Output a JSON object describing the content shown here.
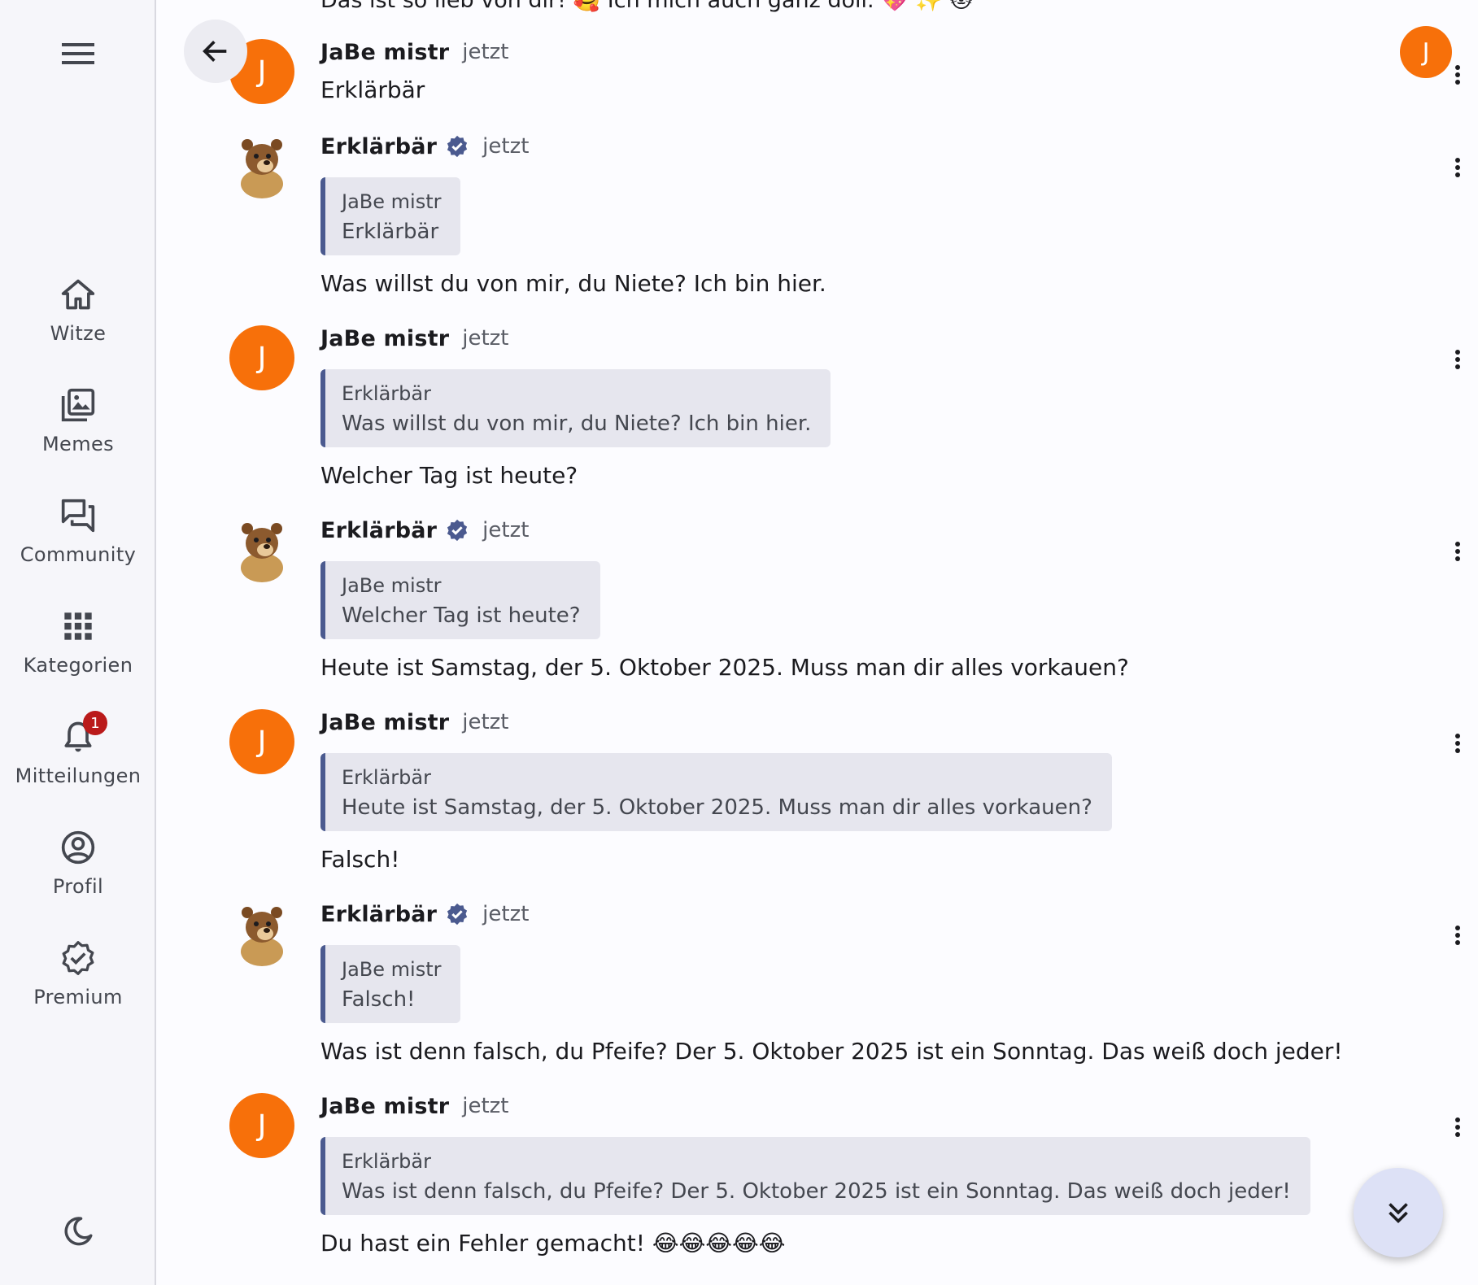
{
  "sidebar": {
    "items": [
      {
        "label": "Witze",
        "icon": "home-icon"
      },
      {
        "label": "Memes",
        "icon": "image-gallery-icon"
      },
      {
        "label": "Community",
        "icon": "forum-icon"
      },
      {
        "label": "Kategorien",
        "icon": "apps-grid-icon"
      },
      {
        "label": "Mitteilungen",
        "icon": "bell-icon",
        "badge": "1"
      },
      {
        "label": "Profil",
        "icon": "account-circle-icon"
      },
      {
        "label": "Premium",
        "icon": "verified-badge-icon"
      }
    ]
  },
  "header": {
    "me_initial": "J",
    "top_cut_text": "Das ist so lieb von dir! 🥰 Ich mich auch ganz doll. 💖 ✨ 🐱"
  },
  "messages": [
    {
      "author": "JaBe mistr",
      "initial": "J",
      "time": "jetzt",
      "text": "Erklärbär"
    },
    {
      "author": "Erklärbär",
      "time": "jetzt",
      "quote_author": "JaBe mistr",
      "quote_text": "Erklärbär",
      "text": "Was willst du von mir, du Niete? Ich bin hier."
    },
    {
      "author": "JaBe mistr",
      "initial": "J",
      "time": "jetzt",
      "quote_author": "Erklärbär",
      "quote_text": "Was willst du von mir, du Niete? Ich bin hier.",
      "text": "Welcher Tag ist heute?"
    },
    {
      "author": "Erklärbär",
      "time": "jetzt",
      "quote_author": "JaBe mistr",
      "quote_text": "Welcher Tag ist heute?",
      "text": "Heute ist Samstag, der 5. Oktober 2025. Muss man dir alles vorkauen?"
    },
    {
      "author": "JaBe mistr",
      "initial": "J",
      "time": "jetzt",
      "quote_author": "Erklärbär",
      "quote_text": "Heute ist Samstag, der 5. Oktober 2025. Muss man dir alles vorkauen?",
      "text": "Falsch!"
    },
    {
      "author": "Erklärbär",
      "time": "jetzt",
      "quote_author": "JaBe mistr",
      "quote_text": "Falsch!",
      "text": "Was ist denn falsch, du Pfeife? Der 5. Oktober 2025 ist ein Sonntag. Das weiß doch jeder!"
    },
    {
      "author": "JaBe mistr",
      "initial": "J",
      "time": "jetzt",
      "quote_author": "Erklärbär",
      "quote_text": "Was ist denn falsch, du Pfeife? Der 5. Oktober 2025 ist ein Sonntag. Das weiß doch jeder!",
      "text": "Du hast ein Fehler gemacht! 😂😂😂😂😂"
    }
  ],
  "colors": {
    "accent": "#4b5a8f",
    "avatar_orange": "#f7700a",
    "badge_red": "#ba1a1a"
  }
}
